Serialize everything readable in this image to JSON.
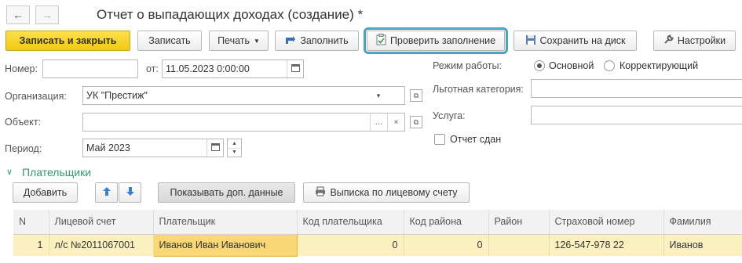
{
  "window": {
    "title": "Отчет о выпадающих доходах (создание) *"
  },
  "toolbar": {
    "save_close": "Записать и закрыть",
    "save": "Записать",
    "print": "Печать",
    "fill": "Заполнить",
    "check_fill": "Проверить заполнение",
    "save_disk": "Сохранить на диск",
    "settings": "Настройки"
  },
  "form": {
    "number_label": "Номер:",
    "number_value": "",
    "date_label": "от:",
    "date_value": "11.05.2023  0:00:00",
    "org_label": "Организация:",
    "org_value": "УК \"Престиж\"",
    "object_label": "Объект:",
    "object_value": "",
    "period_label": "Период:",
    "period_value": "Май 2023",
    "mode_label": "Режим работы:",
    "mode_options": [
      "Основной",
      "Корректирующий"
    ],
    "mode_selected": "Основной",
    "benefit_label": "Льготная категория:",
    "benefit_value": "",
    "service_label": "Услуга:",
    "service_value": "",
    "submitted_label": "Отчет сдан",
    "submitted_checked": false
  },
  "payers": {
    "section_title": "Плательщики",
    "add_button": "Добавить",
    "show_extra_button": "Показывать доп. данные",
    "statement_button": "Выписка по лицевому счету",
    "columns": [
      "N",
      "Лицевой счет",
      "Плательщик",
      "Код плательщика",
      "Код района",
      "Район",
      "Страховой номер",
      "Фамилия"
    ],
    "rows": [
      {
        "n": "1",
        "account": "л/с №2011067001",
        "payer": "Иванов Иван Иванович",
        "payer_code": "0",
        "district_code": "0",
        "district": "",
        "insurance": "126-547-978 22",
        "surname": "Иванов"
      }
    ]
  },
  "colors": {
    "accent_yellow": "#f3c913",
    "highlight_border": "#4aa3c2",
    "section_green": "#2e9b6a",
    "row_bg": "#fdf0c0"
  }
}
